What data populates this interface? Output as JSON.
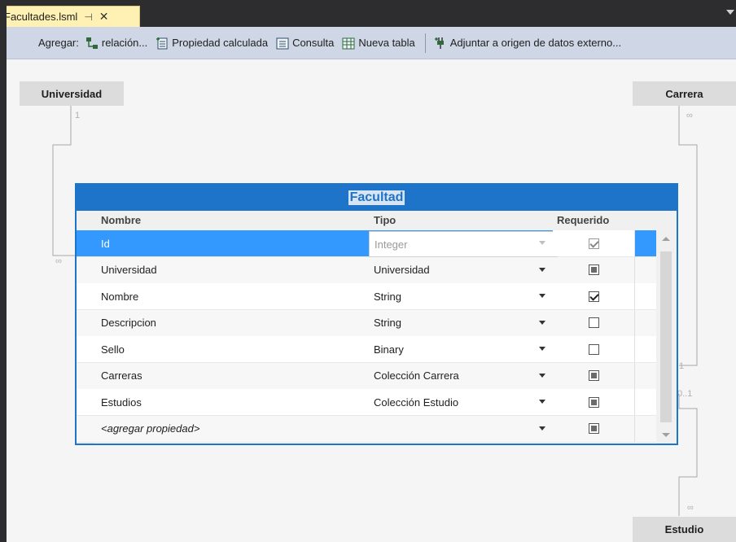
{
  "tab": {
    "title": "Facultades.lsml",
    "pin": "⊣",
    "close": "✕"
  },
  "toolbar": {
    "add_label": "Agregar:",
    "relation": "relación...",
    "computed": "Propiedad calculada",
    "query": "Consulta",
    "new_table": "Nueva tabla",
    "attach": "Adjuntar a origen de datos externo..."
  },
  "canvas": {
    "universidad": {
      "name": "Universidad",
      "mult": "1"
    },
    "carrera": {
      "name": "Carrera",
      "mult": "∞"
    },
    "estudio": {
      "name": "Estudio",
      "mult": "∞"
    },
    "left_mult": "∞",
    "right_mult_1": "1",
    "right_mult_01": "0..1"
  },
  "entity": {
    "title": "Facultad",
    "columns": {
      "name": "Nombre",
      "type": "Tipo",
      "required": "Requerido"
    },
    "rows": [
      {
        "name": "Id",
        "type": "Integer",
        "required": "checked",
        "selected": true,
        "key": true
      },
      {
        "name": "Universidad",
        "type": "Universidad",
        "required": "indeterminate"
      },
      {
        "name": "Nombre",
        "type": "String",
        "required": "checked"
      },
      {
        "name": "Descripcion",
        "type": "String",
        "required": "unchecked"
      },
      {
        "name": "Sello",
        "type": "Binary",
        "required": "unchecked"
      },
      {
        "name": "Carreras",
        "type": "Colección Carrera",
        "required": "indeterminate"
      },
      {
        "name": "Estudios",
        "type": "Colección Estudio",
        "required": "indeterminate"
      },
      {
        "name": "<agregar propiedad>",
        "type": "",
        "required": "indeterminate",
        "placeholder": true
      }
    ]
  }
}
